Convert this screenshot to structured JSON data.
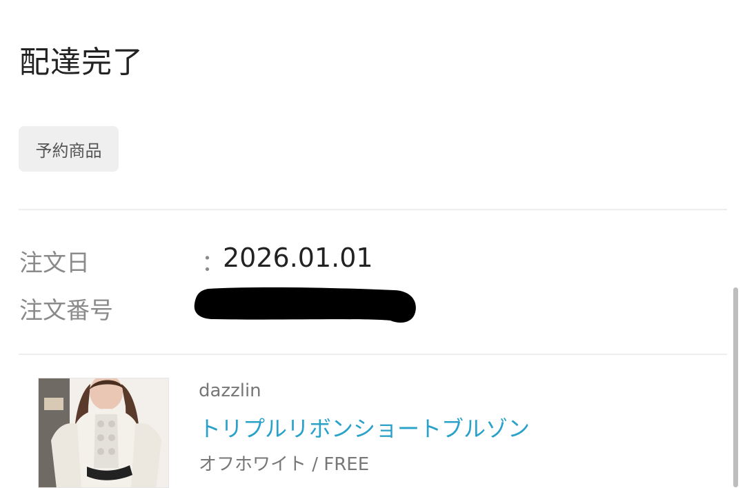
{
  "order": {
    "status": "配達完了",
    "badge": "予約商品",
    "date_label": "注文日",
    "separator": "：",
    "date_value": "2026.01.01",
    "number_label": "注文番号"
  },
  "product": {
    "brand": "dazzlin",
    "name": "トリプルリボンショートブルゾン",
    "variant": "オフホワイト / FREE"
  },
  "colors": {
    "link": "#2aa1c9",
    "text": "#222222",
    "muted": "#8a8a8a"
  }
}
